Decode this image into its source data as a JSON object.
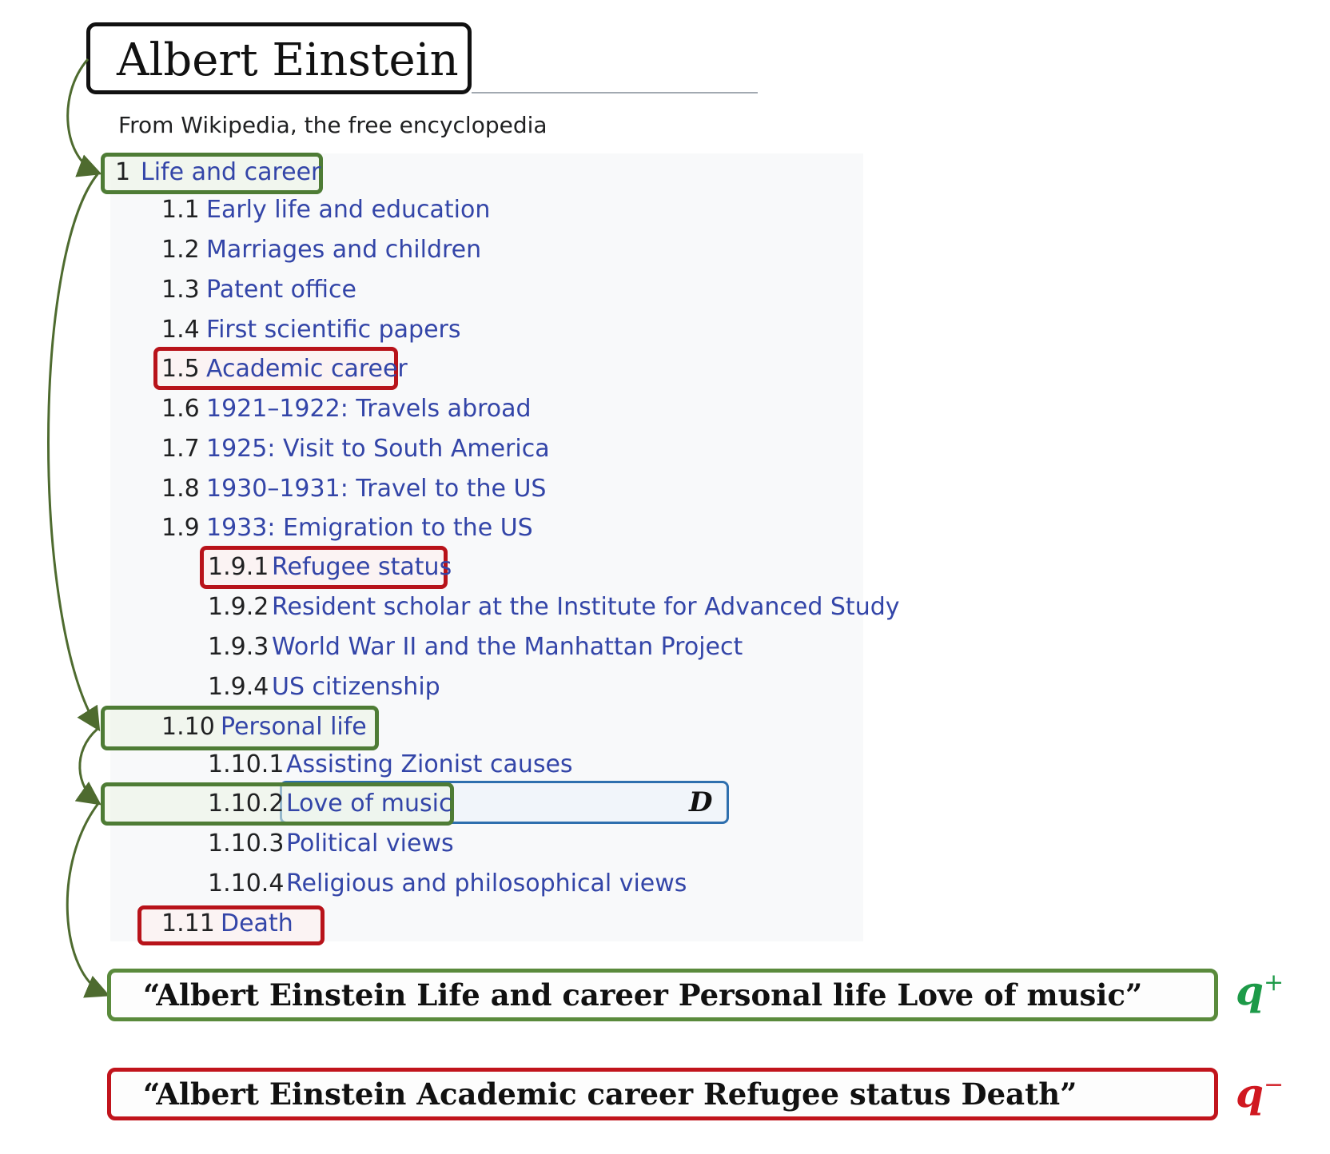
{
  "page": {
    "title": "Albert Einstein",
    "subtitle": "From Wikipedia, the free encyclopedia"
  },
  "toc": {
    "items": [
      {
        "num": "1",
        "label": "Life and career"
      },
      {
        "num": "1.1",
        "label": "Early life and education"
      },
      {
        "num": "1.2",
        "label": "Marriages and children"
      },
      {
        "num": "1.3",
        "label": "Patent office"
      },
      {
        "num": "1.4",
        "label": "First scientific papers"
      },
      {
        "num": "1.5",
        "label": "Academic career"
      },
      {
        "num": "1.6",
        "label": "1921–1922: Travels abroad"
      },
      {
        "num": "1.7",
        "label": "1925: Visit to South America"
      },
      {
        "num": "1.8",
        "label": "1930–1931: Travel to the US"
      },
      {
        "num": "1.9",
        "label": "1933: Emigration to the US"
      },
      {
        "num": "1.9.1",
        "label": "Refugee status"
      },
      {
        "num": "1.9.2",
        "label": "Resident scholar at the Institute for Advanced Study"
      },
      {
        "num": "1.9.3",
        "label": "World War II and the Manhattan Project"
      },
      {
        "num": "1.9.4",
        "label": "US citizenship"
      },
      {
        "num": "1.10",
        "label": "Personal life"
      },
      {
        "num": "1.10.1",
        "label": "Assisting Zionist causes"
      },
      {
        "num": "1.10.2",
        "label": "Love of music"
      },
      {
        "num": "1.10.3",
        "label": "Political views"
      },
      {
        "num": "1.10.4",
        "label": "Religious and philosophical views"
      },
      {
        "num": "1.11",
        "label": "Death"
      }
    ]
  },
  "document_label": "D",
  "queries": {
    "positive": {
      "text": "“Albert Einstein Life and career Personal life Love of music”",
      "label": "q",
      "sign": "+"
    },
    "negative": {
      "text": "“Albert Einstein Academic career Refugee status Death”",
      "label": "q",
      "sign": "−"
    }
  },
  "colors": {
    "positive_path": "#4e7c35",
    "negative": "#b8131a",
    "document": "#2e6fae",
    "link": "#3345a8",
    "q_plus": "#1d9a48",
    "q_minus": "#d01820"
  }
}
